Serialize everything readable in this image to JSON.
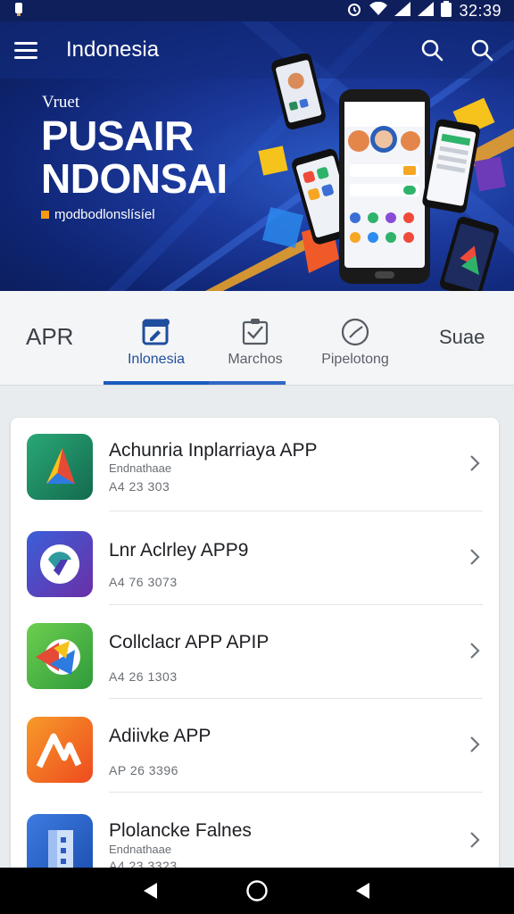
{
  "status_bar": {
    "time": "32:39"
  },
  "appbar": {
    "title": "Indonesia"
  },
  "hero": {
    "kicker": "Vruet",
    "title_line1": "PUSAIR",
    "title_line2": "NDONSAI",
    "subtitle": "ɱodbodlonslísíel"
  },
  "tabs": {
    "left_label": "APR",
    "right_label": "Suae",
    "items": [
      {
        "label": "Inlonesia",
        "active": true
      },
      {
        "label": "Marchos",
        "active": false
      },
      {
        "label": "Pipelotong",
        "active": false
      }
    ]
  },
  "apps": [
    {
      "title": "Achunria Inplarriaya APP",
      "subtitle": "Endnathaae",
      "meta": "A4 23 303",
      "icon": "play-triangle-icon",
      "color": "#1f8a64"
    },
    {
      "title": "Lnr Aclrley APP9",
      "subtitle": "",
      "meta": "A4 76 3073",
      "icon": "swirl-icon",
      "color": "#5b3fb0"
    },
    {
      "title": "Collclacr APP APIP",
      "subtitle": "",
      "meta": "A4 26 1303",
      "icon": "refresh-arrows-icon",
      "color": "#3fa24a"
    },
    {
      "title": "Adiivke APP",
      "subtitle": "",
      "meta": "AP 26 3396",
      "icon": "graph-line-icon",
      "color": "#f0621f"
    },
    {
      "title": "Plolancke Falnes",
      "subtitle": "Endnathaae",
      "meta": "A4 23 3323",
      "icon": "building-icon",
      "color": "#2462c6"
    }
  ],
  "nav": {
    "back": "back-icon",
    "home": "home-icon",
    "recents": "recents-icon"
  }
}
